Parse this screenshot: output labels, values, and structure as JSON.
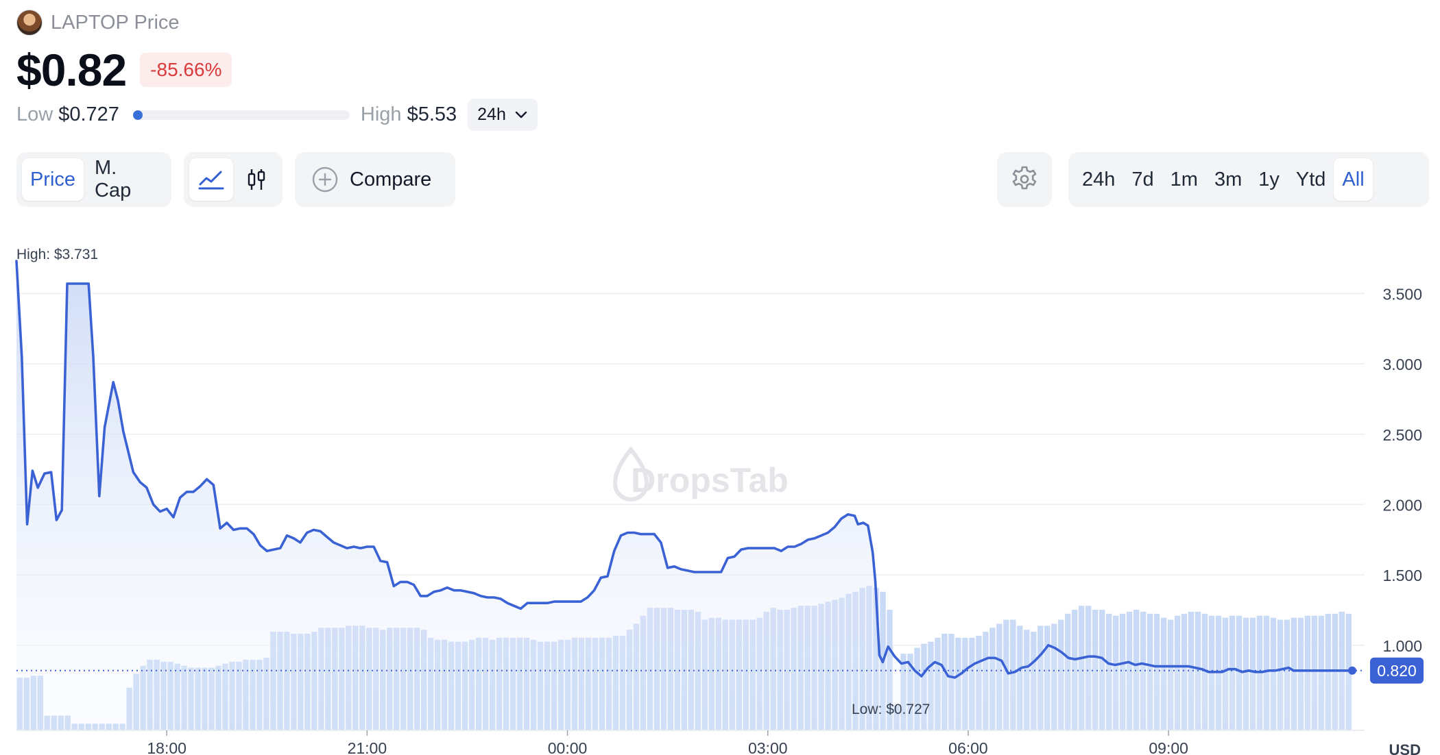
{
  "token": {
    "name": "LAPTOP Price",
    "price": "$0.82",
    "change": "-85.66%"
  },
  "range": {
    "low_label": "Low",
    "low_value": "$0.727",
    "high_label": "High",
    "high_value": "$5.53",
    "period": "24h",
    "fraction": 0.0
  },
  "toolbar": {
    "price_tab": "Price",
    "mcap_tab": "M. Cap",
    "compare_label": "Compare",
    "timeframes": [
      "24h",
      "7d",
      "1m",
      "3m",
      "1y",
      "Ytd",
      "All"
    ],
    "active_timeframe": "All"
  },
  "colors": {
    "accent": "#3a62d4",
    "volume": "#c9daf6",
    "negative": "#d93a3a"
  },
  "icons": {
    "line": "line-chart-icon",
    "candle": "candlestick-icon",
    "compare": "plus-circle-icon",
    "settings": "gear-icon",
    "dropdown": "chevron-down-icon",
    "watermark": "drop-icon"
  },
  "chart_data": {
    "type": "line",
    "watermark": "DropsTab",
    "high_label": "High: $3.731",
    "low_label": "Low: $0.727",
    "current_label": "0.820",
    "currency_label": "USD",
    "x_ticks": [
      {
        "label": "18:00",
        "t": 2.25
      },
      {
        "label": "21:00",
        "t": 5.25
      },
      {
        "label": "00:00",
        "t": 8.25
      },
      {
        "label": "03:00",
        "t": 11.25
      },
      {
        "label": "06:00",
        "t": 14.25
      },
      {
        "label": "09:00",
        "t": 17.25
      }
    ],
    "y_ticks": [
      "1.000",
      "1.500",
      "2.000",
      "2.500",
      "3.000",
      "3.500"
    ],
    "ylim": [
      0.4,
      3.76
    ],
    "xlim": [
      0,
      18.6
    ],
    "current_value": 0.82,
    "series": [
      {
        "values": [
          [
            0.0,
            3.731
          ],
          [
            0.08,
            3.05
          ],
          [
            0.16,
            1.86
          ],
          [
            0.24,
            2.24
          ],
          [
            0.32,
            2.12
          ],
          [
            0.42,
            2.22
          ],
          [
            0.52,
            2.23
          ],
          [
            0.6,
            1.89
          ],
          [
            0.68,
            1.96
          ],
          [
            0.76,
            3.57
          ],
          [
            0.95,
            3.57
          ],
          [
            1.08,
            3.57
          ],
          [
            1.15,
            3.05
          ],
          [
            1.24,
            2.06
          ],
          [
            1.32,
            2.55
          ],
          [
            1.45,
            2.87
          ],
          [
            1.52,
            2.74
          ],
          [
            1.6,
            2.52
          ],
          [
            1.75,
            2.23
          ],
          [
            1.85,
            2.16
          ],
          [
            1.95,
            2.12
          ],
          [
            2.05,
            2.0
          ],
          [
            2.15,
            1.95
          ],
          [
            2.25,
            1.97
          ],
          [
            2.35,
            1.91
          ],
          [
            2.45,
            2.05
          ],
          [
            2.55,
            2.09
          ],
          [
            2.65,
            2.09
          ],
          [
            2.75,
            2.13
          ],
          [
            2.85,
            2.18
          ],
          [
            2.95,
            2.14
          ],
          [
            3.05,
            1.83
          ],
          [
            3.15,
            1.87
          ],
          [
            3.25,
            1.82
          ],
          [
            3.35,
            1.83
          ],
          [
            3.45,
            1.83
          ],
          [
            3.55,
            1.79
          ],
          [
            3.65,
            1.71
          ],
          [
            3.75,
            1.67
          ],
          [
            3.85,
            1.68
          ],
          [
            3.95,
            1.69
          ],
          [
            4.05,
            1.78
          ],
          [
            4.15,
            1.76
          ],
          [
            4.25,
            1.73
          ],
          [
            4.35,
            1.8
          ],
          [
            4.45,
            1.82
          ],
          [
            4.55,
            1.81
          ],
          [
            4.65,
            1.77
          ],
          [
            4.75,
            1.73
          ],
          [
            4.85,
            1.71
          ],
          [
            4.95,
            1.69
          ],
          [
            5.05,
            1.7
          ],
          [
            5.15,
            1.69
          ],
          [
            5.25,
            1.7
          ],
          [
            5.35,
            1.7
          ],
          [
            5.45,
            1.6
          ],
          [
            5.55,
            1.59
          ],
          [
            5.65,
            1.42
          ],
          [
            5.75,
            1.45
          ],
          [
            5.85,
            1.45
          ],
          [
            5.95,
            1.43
          ],
          [
            6.05,
            1.35
          ],
          [
            6.15,
            1.35
          ],
          [
            6.25,
            1.38
          ],
          [
            6.35,
            1.39
          ],
          [
            6.45,
            1.41
          ],
          [
            6.55,
            1.39
          ],
          [
            6.65,
            1.39
          ],
          [
            6.75,
            1.38
          ],
          [
            6.85,
            1.37
          ],
          [
            6.95,
            1.35
          ],
          [
            7.05,
            1.34
          ],
          [
            7.15,
            1.34
          ],
          [
            7.25,
            1.33
          ],
          [
            7.35,
            1.3
          ],
          [
            7.45,
            1.28
          ],
          [
            7.55,
            1.26
          ],
          [
            7.65,
            1.3
          ],
          [
            7.75,
            1.3
          ],
          [
            7.85,
            1.3
          ],
          [
            7.95,
            1.3
          ],
          [
            8.05,
            1.31
          ],
          [
            8.15,
            1.31
          ],
          [
            8.25,
            1.31
          ],
          [
            8.35,
            1.31
          ],
          [
            8.45,
            1.31
          ],
          [
            8.55,
            1.34
          ],
          [
            8.65,
            1.39
          ],
          [
            8.75,
            1.48
          ],
          [
            8.85,
            1.49
          ],
          [
            8.95,
            1.67
          ],
          [
            9.05,
            1.78
          ],
          [
            9.15,
            1.8
          ],
          [
            9.25,
            1.8
          ],
          [
            9.35,
            1.79
          ],
          [
            9.45,
            1.79
          ],
          [
            9.55,
            1.79
          ],
          [
            9.65,
            1.73
          ],
          [
            9.75,
            1.55
          ],
          [
            9.85,
            1.56
          ],
          [
            9.95,
            1.54
          ],
          [
            10.05,
            1.53
          ],
          [
            10.15,
            1.52
          ],
          [
            10.25,
            1.52
          ],
          [
            10.35,
            1.52
          ],
          [
            10.45,
            1.52
          ],
          [
            10.55,
            1.52
          ],
          [
            10.65,
            1.62
          ],
          [
            10.75,
            1.63
          ],
          [
            10.85,
            1.68
          ],
          [
            10.95,
            1.69
          ],
          [
            11.05,
            1.69
          ],
          [
            11.15,
            1.69
          ],
          [
            11.25,
            1.69
          ],
          [
            11.35,
            1.69
          ],
          [
            11.45,
            1.67
          ],
          [
            11.55,
            1.7
          ],
          [
            11.65,
            1.7
          ],
          [
            11.75,
            1.72
          ],
          [
            11.85,
            1.75
          ],
          [
            11.95,
            1.76
          ],
          [
            12.05,
            1.78
          ],
          [
            12.15,
            1.8
          ],
          [
            12.25,
            1.84
          ],
          [
            12.35,
            1.9
          ],
          [
            12.45,
            1.93
          ],
          [
            12.55,
            1.92
          ],
          [
            12.6,
            1.86
          ],
          [
            12.68,
            1.87
          ],
          [
            12.75,
            1.85
          ],
          [
            12.82,
            1.66
          ],
          [
            12.86,
            1.45
          ],
          [
            12.92,
            0.93
          ],
          [
            12.97,
            0.88
          ],
          [
            13.05,
            0.99
          ],
          [
            13.15,
            0.92
          ],
          [
            13.25,
            0.87
          ],
          [
            13.35,
            0.88
          ],
          [
            13.45,
            0.82
          ],
          [
            13.55,
            0.78
          ],
          [
            13.65,
            0.84
          ],
          [
            13.75,
            0.88
          ],
          [
            13.85,
            0.86
          ],
          [
            13.95,
            0.78
          ],
          [
            14.05,
            0.77
          ],
          [
            14.15,
            0.8
          ],
          [
            14.25,
            0.84
          ],
          [
            14.35,
            0.87
          ],
          [
            14.45,
            0.89
          ],
          [
            14.55,
            0.91
          ],
          [
            14.65,
            0.91
          ],
          [
            14.75,
            0.89
          ],
          [
            14.85,
            0.8
          ],
          [
            14.95,
            0.81
          ],
          [
            15.05,
            0.84
          ],
          [
            15.15,
            0.85
          ],
          [
            15.25,
            0.89
          ],
          [
            15.35,
            0.94
          ],
          [
            15.45,
            1.0
          ],
          [
            15.55,
            0.98
          ],
          [
            15.65,
            0.95
          ],
          [
            15.75,
            0.91
          ],
          [
            15.85,
            0.9
          ],
          [
            15.95,
            0.91
          ],
          [
            16.05,
            0.92
          ],
          [
            16.15,
            0.92
          ],
          [
            16.25,
            0.91
          ],
          [
            16.35,
            0.87
          ],
          [
            16.45,
            0.86
          ],
          [
            16.55,
            0.87
          ],
          [
            16.65,
            0.88
          ],
          [
            16.75,
            0.86
          ],
          [
            16.85,
            0.87
          ],
          [
            16.95,
            0.86
          ],
          [
            17.05,
            0.85
          ],
          [
            17.15,
            0.85
          ],
          [
            17.25,
            0.85
          ],
          [
            17.35,
            0.85
          ],
          [
            17.45,
            0.85
          ],
          [
            17.55,
            0.85
          ],
          [
            17.65,
            0.84
          ],
          [
            17.75,
            0.83
          ],
          [
            17.85,
            0.81
          ],
          [
            17.95,
            0.81
          ],
          [
            18.05,
            0.81
          ],
          [
            18.15,
            0.83
          ],
          [
            18.25,
            0.83
          ],
          [
            18.35,
            0.81
          ],
          [
            18.45,
            0.82
          ],
          [
            18.55,
            0.81
          ],
          [
            18.65,
            0.81
          ],
          [
            18.75,
            0.82
          ],
          [
            18.85,
            0.82
          ],
          [
            18.95,
            0.83
          ],
          [
            19.05,
            0.84
          ],
          [
            19.12,
            0.82
          ],
          [
            19.19,
            0.82
          ],
          [
            19.25,
            0.82
          ],
          [
            19.4,
            0.82
          ],
          [
            19.55,
            0.82
          ],
          [
            19.65,
            0.82
          ],
          [
            19.75,
            0.82
          ],
          [
            19.85,
            0.82
          ],
          [
            19.95,
            0.82
          ],
          [
            20.0,
            0.82
          ]
        ]
      },
      {
        "values": [
          0.26,
          0.26,
          0.27,
          0.27,
          0.07,
          0.07,
          0.07,
          0.07,
          0.03,
          0.03,
          0.03,
          0.03,
          0.03,
          0.03,
          0.03,
          0.03,
          0.21,
          0.28,
          0.32,
          0.35,
          0.35,
          0.34,
          0.34,
          0.33,
          0.32,
          0.31,
          0.31,
          0.31,
          0.31,
          0.32,
          0.33,
          0.34,
          0.34,
          0.35,
          0.35,
          0.35,
          0.36,
          0.49,
          0.49,
          0.49,
          0.48,
          0.48,
          0.48,
          0.49,
          0.51,
          0.51,
          0.51,
          0.51,
          0.52,
          0.52,
          0.52,
          0.51,
          0.51,
          0.5,
          0.51,
          0.51,
          0.51,
          0.51,
          0.51,
          0.5,
          0.46,
          0.45,
          0.45,
          0.44,
          0.44,
          0.44,
          0.45,
          0.46,
          0.46,
          0.45,
          0.46,
          0.46,
          0.46,
          0.46,
          0.46,
          0.45,
          0.44,
          0.44,
          0.44,
          0.45,
          0.45,
          0.46,
          0.46,
          0.46,
          0.46,
          0.46,
          0.46,
          0.47,
          0.47,
          0.5,
          0.53,
          0.57,
          0.61,
          0.61,
          0.61,
          0.61,
          0.6,
          0.6,
          0.6,
          0.59,
          0.55,
          0.56,
          0.56,
          0.55,
          0.55,
          0.55,
          0.55,
          0.55,
          0.56,
          0.59,
          0.61,
          0.6,
          0.6,
          0.61,
          0.62,
          0.62,
          0.62,
          0.63,
          0.64,
          0.65,
          0.66,
          0.68,
          0.69,
          0.71,
          0.72,
          0.71,
          0.69,
          0.6,
          0.12,
          0.38,
          0.38,
          0.41,
          0.43,
          0.44,
          0.46,
          0.48,
          0.48,
          0.46,
          0.46,
          0.46,
          0.47,
          0.49,
          0.51,
          0.53,
          0.55,
          0.55,
          0.52,
          0.5,
          0.49,
          0.52,
          0.52,
          0.53,
          0.55,
          0.58,
          0.6,
          0.62,
          0.62,
          0.6,
          0.6,
          0.58,
          0.57,
          0.58,
          0.59,
          0.6,
          0.59,
          0.58,
          0.58,
          0.56,
          0.55,
          0.57,
          0.58,
          0.59,
          0.59,
          0.58,
          0.57,
          0.57,
          0.56,
          0.57,
          0.57,
          0.56,
          0.56,
          0.57,
          0.57,
          0.56,
          0.55,
          0.55,
          0.56,
          0.56,
          0.57,
          0.57,
          0.57,
          0.58,
          0.58,
          0.59,
          0.58
        ]
      }
    ]
  }
}
